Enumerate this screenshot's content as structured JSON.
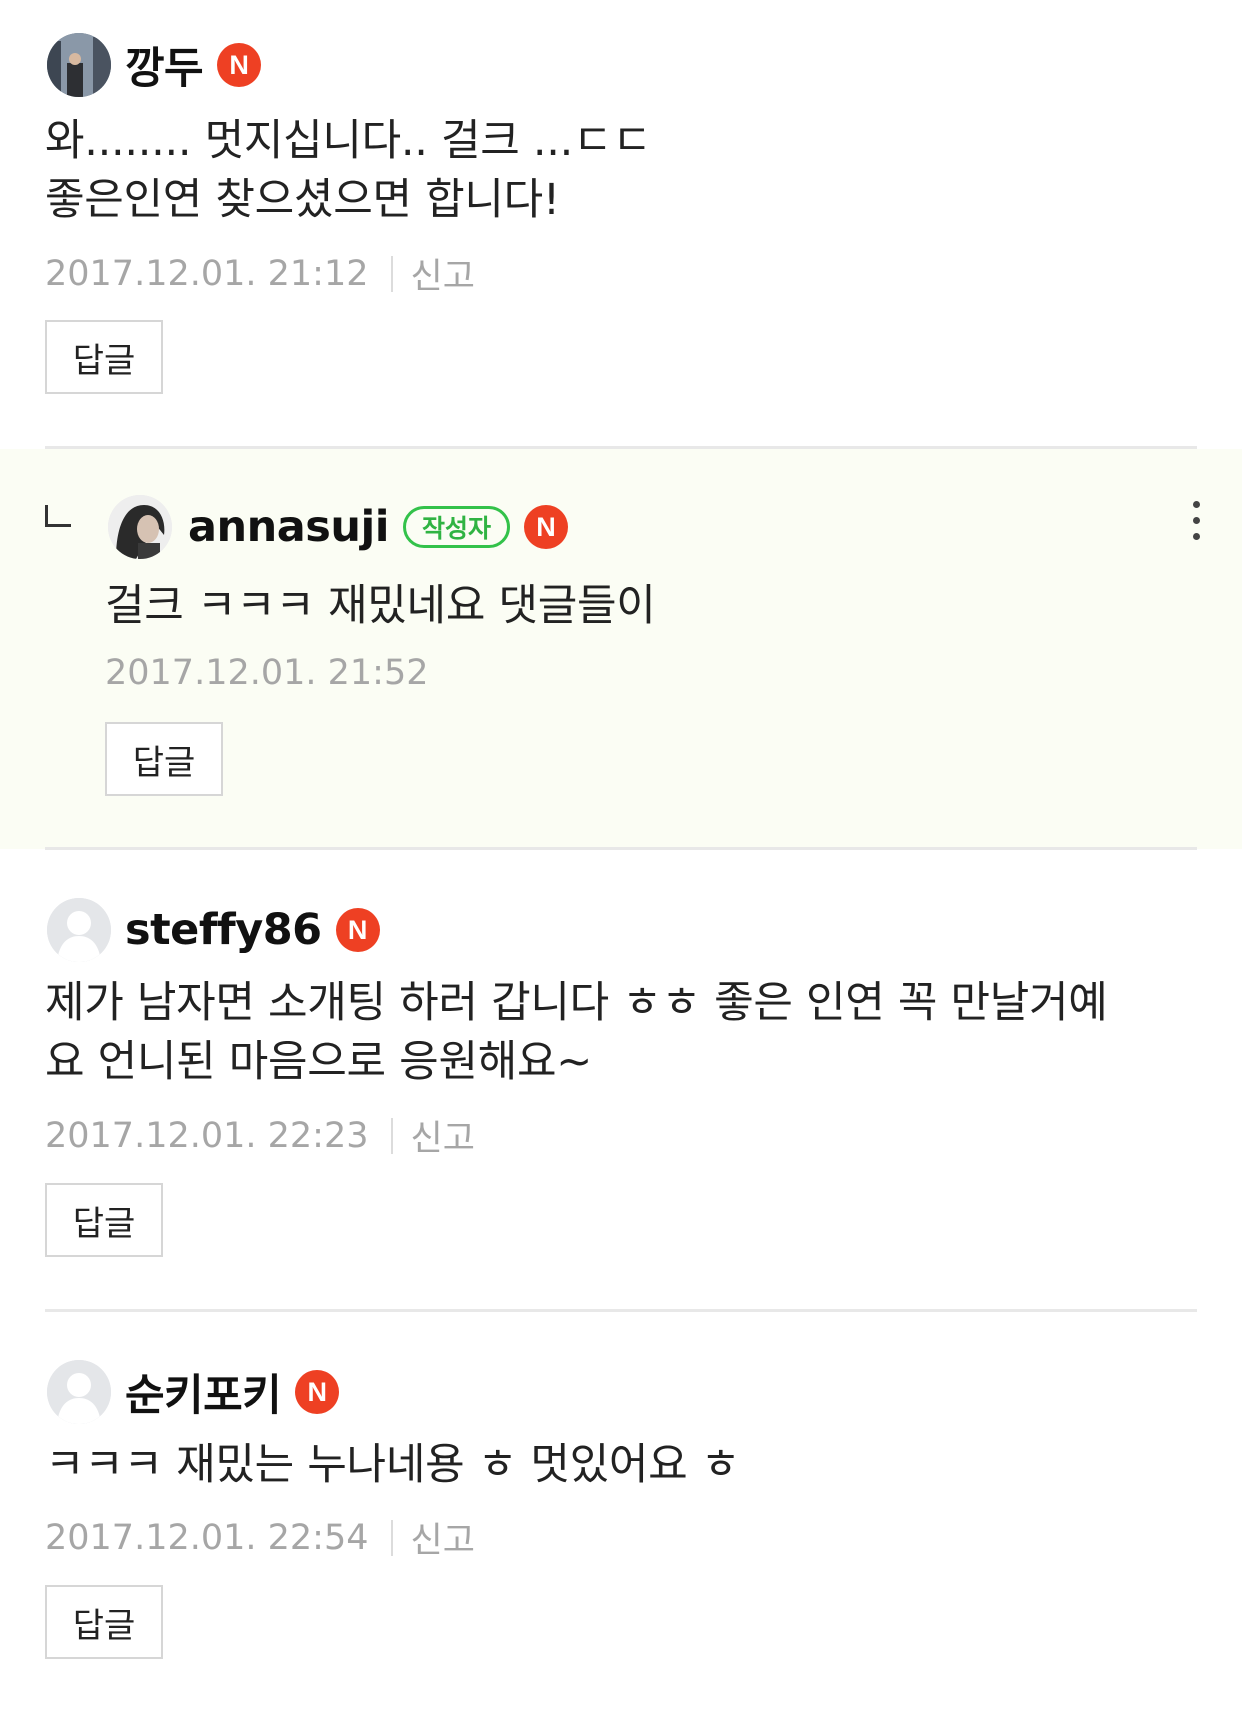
{
  "comments": [
    {
      "nickname": "깡두",
      "badge": "N",
      "text": "와........ 멋지십니다.. 걸크 ...ㄷㄷ\n좋은인연 찾으셨으면 합니다!",
      "date": "2017.12.01. 21:12",
      "report_label": "신고",
      "reply_label": "답글"
    },
    {
      "nickname": "annasuji",
      "author_tag": "작성자",
      "badge": "N",
      "text": "걸크 ㅋㅋㅋ 재밌네요 댓글들이",
      "date": "2017.12.01. 21:52",
      "reply_label": "답글"
    },
    {
      "nickname": "steffy86",
      "badge": "N",
      "text": "제가 남자면 소개팅 하러 갑니다 ㅎㅎ 좋은 인연 꼭 만날거예\n요 언니된 마음으로 응원해요~",
      "date": "2017.12.01. 22:23",
      "report_label": "신고",
      "reply_label": "답글"
    },
    {
      "nickname": "순키포키",
      "badge": "N",
      "text": "ㅋㅋㅋ 재밌는 누나네용 ㅎ 멋있어요 ㅎ",
      "date": "2017.12.01. 22:54",
      "report_label": "신고",
      "reply_label": "답글"
    }
  ],
  "colors": {
    "badge_red": "#ee4023",
    "author_green": "#33c24a",
    "reply_bg": "#fbfdf4",
    "meta_gray": "#a6a6a6"
  },
  "icons": {
    "reply_indicator": "reply-arrow-icon",
    "more_menu": "more-vertical-icon"
  }
}
